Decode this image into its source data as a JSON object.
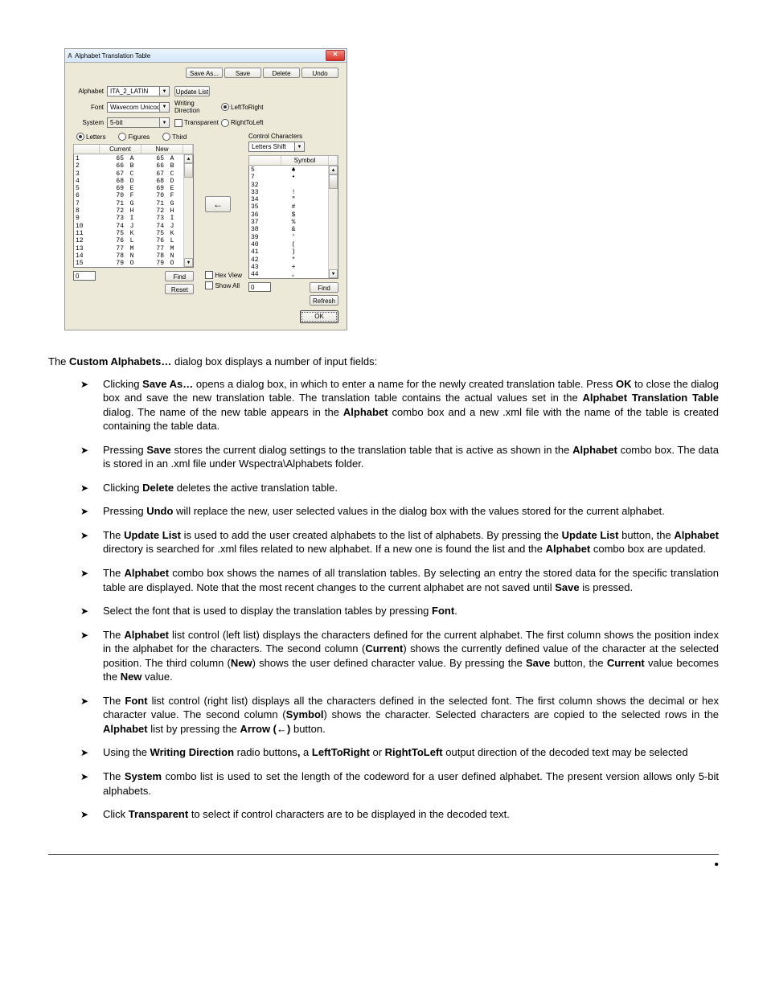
{
  "dialog": {
    "title": "Alphabet Translation Table",
    "buttons": {
      "saveAs": "Save As...",
      "save": "Save",
      "delete": "Delete",
      "undo": "Undo",
      "updateList": "Update List",
      "find": "Find",
      "reset": "Reset",
      "refresh": "Refresh",
      "ok": "OK"
    },
    "labels": {
      "alphabet": "Alphabet",
      "font": "Font",
      "system": "System",
      "writingDir": "Writing Direction",
      "ltr": "LeftToRight",
      "rtl": "RightToLeft",
      "transparent": "Transparent",
      "letters": "Letters",
      "figures": "Figures",
      "third": "Third",
      "controlChars": "Control Characters",
      "hexView": "Hex View",
      "showAll": "Show All"
    },
    "values": {
      "alphabet": "ITA_2_LATIN",
      "font": "Wavecom Unicode",
      "system": "5-bit",
      "controlChars": "Letters Shift",
      "leftFind": "0",
      "rightFind": "0"
    },
    "leftHeaders": {
      "blank": "",
      "current": "Current",
      "new": "New"
    },
    "rightHeaders": {
      "blank": "",
      "symbol": "Symbol"
    },
    "alphabetRows": [
      {
        "idx": "1",
        "cur": "65",
        "curc": "A",
        "new": "65",
        "newc": "A"
      },
      {
        "idx": "2",
        "cur": "66",
        "curc": "B",
        "new": "66",
        "newc": "B"
      },
      {
        "idx": "3",
        "cur": "67",
        "curc": "C",
        "new": "67",
        "newc": "C"
      },
      {
        "idx": "4",
        "cur": "68",
        "curc": "D",
        "new": "68",
        "newc": "D"
      },
      {
        "idx": "5",
        "cur": "69",
        "curc": "E",
        "new": "69",
        "newc": "E"
      },
      {
        "idx": "6",
        "cur": "70",
        "curc": "F",
        "new": "70",
        "newc": "F"
      },
      {
        "idx": "7",
        "cur": "71",
        "curc": "G",
        "new": "71",
        "newc": "G"
      },
      {
        "idx": "8",
        "cur": "72",
        "curc": "H",
        "new": "72",
        "newc": "H"
      },
      {
        "idx": "9",
        "cur": "73",
        "curc": "I",
        "new": "73",
        "newc": "I"
      },
      {
        "idx": "10",
        "cur": "74",
        "curc": "J",
        "new": "74",
        "newc": "J"
      },
      {
        "idx": "11",
        "cur": "75",
        "curc": "K",
        "new": "75",
        "newc": "K"
      },
      {
        "idx": "12",
        "cur": "76",
        "curc": "L",
        "new": "76",
        "newc": "L"
      },
      {
        "idx": "13",
        "cur": "77",
        "curc": "M",
        "new": "77",
        "newc": "M"
      },
      {
        "idx": "14",
        "cur": "78",
        "curc": "N",
        "new": "78",
        "newc": "N"
      },
      {
        "idx": "15",
        "cur": "79",
        "curc": "O",
        "new": "79",
        "newc": "O"
      }
    ],
    "fontRows": [
      {
        "code": "5",
        "sym": "♣"
      },
      {
        "code": "7",
        "sym": "•"
      },
      {
        "code": "32",
        "sym": ""
      },
      {
        "code": "33",
        "sym": "!"
      },
      {
        "code": "34",
        "sym": "\""
      },
      {
        "code": "35",
        "sym": "#"
      },
      {
        "code": "36",
        "sym": "$"
      },
      {
        "code": "37",
        "sym": "%"
      },
      {
        "code": "38",
        "sym": "&"
      },
      {
        "code": "39",
        "sym": "'"
      },
      {
        "code": "40",
        "sym": "("
      },
      {
        "code": "41",
        "sym": ")"
      },
      {
        "code": "42",
        "sym": "*"
      },
      {
        "code": "43",
        "sym": "+"
      },
      {
        "code": "44",
        "sym": ","
      }
    ]
  },
  "doc": {
    "intro_a": "The ",
    "intro_b": "Custom Alphabets…",
    "intro_c": " dialog box displays a number of input fields:",
    "items": [
      "Clicking <b>Save As…</b> opens a dialog box, in which to enter a name for the newly created translation table. Press <b>OK</b> to close the dialog box and save the new translation table. The translation table contains the actual values set in the <b>Alphabet Translation Table</b> dialog. The name of the new table appears in the <b>Alphabet</b> combo box and a new .xml file with the name of the table is created containing the table data.",
      "Pressing <b>Save</b> stores the current dialog settings to the translation table that is active as shown in the <b>Alphabet</b> combo box. The data is stored in an .xml file under Wspectra\\Alphabets folder.",
      "Clicking <b>Delete</b> deletes the active translation table.",
      "Pressing <b>Undo</b> will replace the new, user selected values in the dialog box with the values stored for the current alphabet.",
      "The <b>Update List</b> is used to add the user created alphabets to the list of alphabets. By pressing the <b>Update List</b> button, the <b>Alphabet</b> directory is searched for .xml files related to new alphabet. If a new one is found the list and the <b>Alphabet</b> combo box are updated.",
      "The <b>Alphabet</b> combo box shows the names of all translation tables. By selecting an entry the stored data for the specific translation table are displayed. Note that the most recent changes to the current alphabet are not saved until <b>Save</b> is pressed.",
      "Select the font that is used to display the translation tables by pressing <b>Font</b>.",
      "The <b>Alphabet</b> list control (left list) displays the characters defined for the current alphabet. The first column shows the position index in the alphabet for the characters. The second column (<b>Current</b>) shows the currently defined value of the character at the selected position. The third column (<b>New</b>) shows the user defined character value. By pressing the <b>Save</b> button, the <b>Current</b> value becomes the <b>New</b> value.",
      "The <b>Font</b> list control (right list) displays all the characters defined in the selected font. The first column shows the decimal or hex character value. The second column (<b>Symbol</b>) shows the character. Selected characters are copied to the selected rows in the <b>Alphabet</b> list by pressing the <b>Arrow (←)</b> button.",
      "Using the <b>Writing Direction</b> radio buttons<b>,</b> a <b>LeftToRight</b> or <b>RightToLeft</b> output direction of the decoded text may be selected",
      "The <b>System</b> combo list is used to set the length of the codeword for a user defined alphabet. The present version allows only 5-bit alphabets.",
      "Click <b>Transparent</b> to select if control characters are to be displayed in the decoded text."
    ]
  }
}
